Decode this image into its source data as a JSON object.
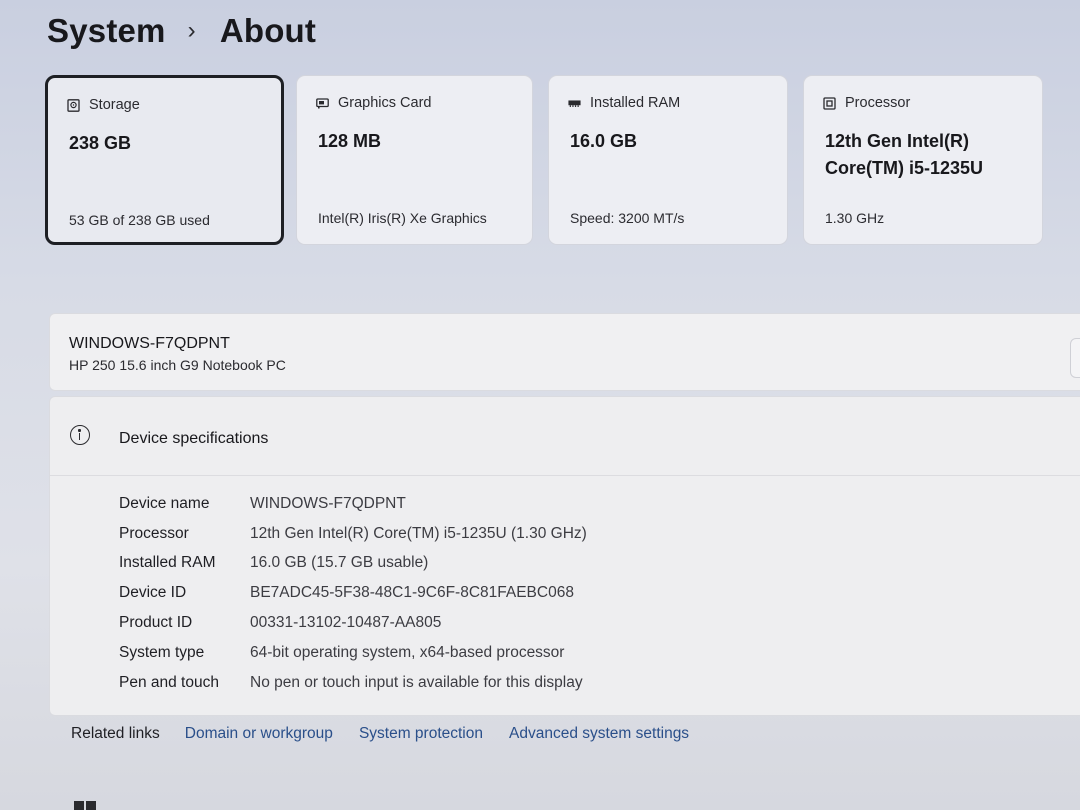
{
  "breadcrumb": {
    "parent": "System",
    "separator": "›",
    "current": "About"
  },
  "cards": [
    {
      "icon": "storage-icon",
      "label": "Storage",
      "value": "238 GB",
      "footer": "53 GB of 238 GB used"
    },
    {
      "icon": "graphics-card-icon",
      "label": "Graphics Card",
      "value": "128 MB",
      "footer": "Intel(R) Iris(R) Xe Graphics"
    },
    {
      "icon": "ram-icon",
      "label": "Installed RAM",
      "value": "16.0 GB",
      "footer": "Speed: 3200 MT/s"
    },
    {
      "icon": "processor-icon",
      "label": "Processor",
      "value_line1": "12th Gen Intel(R)",
      "value_line2": "Core(TM) i5-1235U",
      "footer": "1.30 GHz"
    }
  ],
  "device": {
    "name": "WINDOWS-F7QDPNT",
    "model": "HP 250 15.6 inch G9 Notebook PC"
  },
  "specs": {
    "title": "Device specifications",
    "rows": [
      {
        "key": "Device name",
        "value": "WINDOWS-F7QDPNT"
      },
      {
        "key": "Processor",
        "value": "12th Gen Intel(R) Core(TM) i5-1235U (1.30 GHz)"
      },
      {
        "key": "Installed RAM",
        "value": "16.0 GB (15.7 GB usable)"
      },
      {
        "key": "Device ID",
        "value": "BE7ADC45-5F38-48C1-9C6F-8C81FAEBC068"
      },
      {
        "key": "Product ID",
        "value": "00331-13102-10487-AA805"
      },
      {
        "key": "System type",
        "value": "64-bit operating system, x64-based processor"
      },
      {
        "key": "Pen and touch",
        "value": "No pen or touch input is available for this display"
      }
    ]
  },
  "related": {
    "label": "Related links",
    "links": [
      "Domain or workgroup",
      "System protection",
      "Advanced system settings"
    ]
  },
  "colors": {
    "link": "#2a4f8a",
    "selected_border": "#1d1f24"
  }
}
